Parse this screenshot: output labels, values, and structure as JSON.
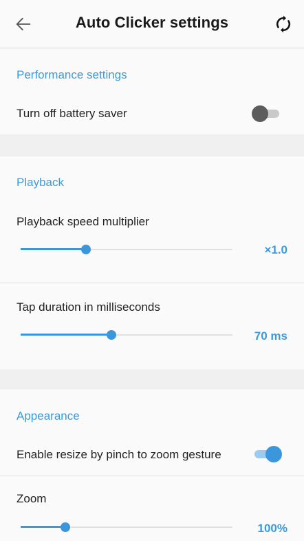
{
  "app_bar": {
    "title": "Auto Clicker settings",
    "back_icon": "arrow-left-icon",
    "refresh_icon": "sync-icon"
  },
  "sections": {
    "performance": {
      "header": "Performance settings",
      "battery_saver": {
        "label": "Turn off battery saver",
        "enabled": false
      }
    },
    "playback": {
      "header": "Playback",
      "speed": {
        "label": "Playback speed multiplier",
        "value_text": "×1.0",
        "level": 0.31
      },
      "tap_duration": {
        "label": "Tap duration in milliseconds",
        "value_text": "70 ms",
        "level": 0.43
      }
    },
    "appearance": {
      "header": "Appearance",
      "pinch_resize": {
        "label": "Enable resize by pinch to zoom gesture",
        "enabled": true
      },
      "zoom": {
        "label": "Zoom",
        "value_text": "100%",
        "level": 0.21
      }
    }
  },
  "colors": {
    "accent": "#3b96dc",
    "section_header": "#3d9ad9",
    "background": "#f0f0f0",
    "surface": "#fafafa"
  }
}
